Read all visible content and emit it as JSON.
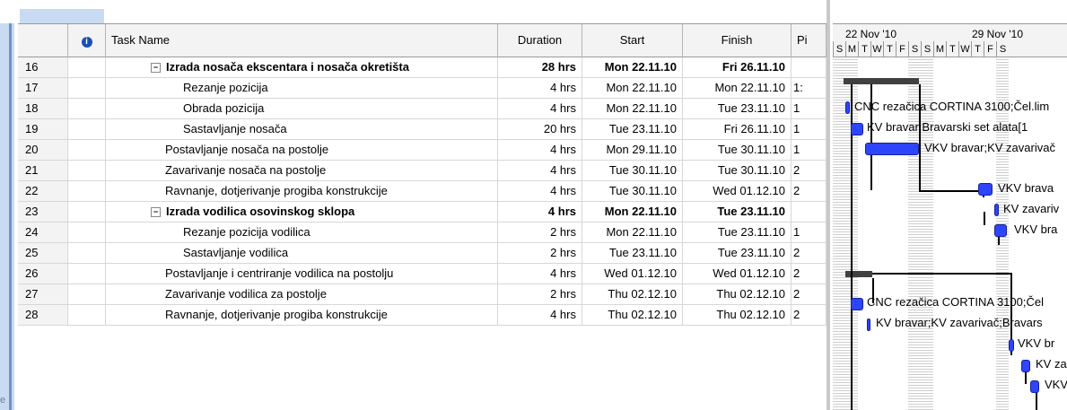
{
  "columns": {
    "info_icon": "i",
    "task_name": "Task Name",
    "duration": "Duration",
    "start": "Start",
    "finish": "Finish",
    "predecessors": "Pi"
  },
  "rows": [
    {
      "id": "16",
      "name": "Izrada nosača ekscentara i nosača okretišta",
      "duration": "28 hrs",
      "start": "Mon 22.11.10",
      "finish": "Fri 26.11.10",
      "pred": "",
      "level": 1,
      "summary": true
    },
    {
      "id": "17",
      "name": "Rezanje pozicija",
      "duration": "4 hrs",
      "start": "Mon 22.11.10",
      "finish": "Mon 22.11.10",
      "pred": "1:",
      "level": 2,
      "summary": false
    },
    {
      "id": "18",
      "name": "Obrada pozicija",
      "duration": "4 hrs",
      "start": "Mon 22.11.10",
      "finish": "Tue 23.11.10",
      "pred": "1",
      "level": 2,
      "summary": false
    },
    {
      "id": "19",
      "name": "Sastavljanje nosača",
      "duration": "20 hrs",
      "start": "Tue 23.11.10",
      "finish": "Fri 26.11.10",
      "pred": "1",
      "level": 2,
      "summary": false
    },
    {
      "id": "20",
      "name": "Postavljanje nosača na postolje",
      "duration": "4 hrs",
      "start": "Mon 29.11.10",
      "finish": "Tue 30.11.10",
      "pred": "1",
      "level": 0,
      "summary": false
    },
    {
      "id": "21",
      "name": "Zavarivanje nosača na postolje",
      "duration": "4 hrs",
      "start": "Tue 30.11.10",
      "finish": "Tue 30.11.10",
      "pred": "2",
      "level": 0,
      "summary": false
    },
    {
      "id": "22",
      "name": "Ravnanje, dotjerivanje progiba konstrukcije",
      "duration": "4 hrs",
      "start": "Tue 30.11.10",
      "finish": "Wed 01.12.10",
      "pred": "2",
      "level": 0,
      "summary": false
    },
    {
      "id": "23",
      "name": "Izrada vodilica osovinskog sklopa",
      "duration": "4 hrs",
      "start": "Mon 22.11.10",
      "finish": "Tue 23.11.10",
      "pred": "",
      "level": 1,
      "summary": true
    },
    {
      "id": "24",
      "name": "Rezanje pozicija vodilica",
      "duration": "2 hrs",
      "start": "Mon 22.11.10",
      "finish": "Tue 23.11.10",
      "pred": "1",
      "level": 2,
      "summary": false
    },
    {
      "id": "25",
      "name": "Sastavljanje vodilica",
      "duration": "2 hrs",
      "start": "Tue 23.11.10",
      "finish": "Tue 23.11.10",
      "pred": "2",
      "level": 2,
      "summary": false
    },
    {
      "id": "26",
      "name": "Postavljanje i centriranje vodilica na postolju",
      "duration": "4 hrs",
      "start": "Wed 01.12.10",
      "finish": "Wed 01.12.10",
      "pred": "2",
      "level": 0,
      "summary": false
    },
    {
      "id": "27",
      "name": "Zavarivanje vodilica za postolje",
      "duration": "2 hrs",
      "start": "Thu 02.12.10",
      "finish": "Thu 02.12.10",
      "pred": "2",
      "level": 0,
      "summary": false
    },
    {
      "id": "28",
      "name": "Ravnanje, dotjerivanje progiba konstrukcije",
      "duration": "4 hrs",
      "start": "Thu 02.12.10",
      "finish": "Thu 02.12.10",
      "pred": "2",
      "level": 0,
      "summary": false
    }
  ],
  "gantt": {
    "weeks": [
      "22 Nov '10",
      "29 Nov '10"
    ],
    "days": [
      "S",
      "M",
      "T",
      "W",
      "T",
      "F",
      "S",
      "S",
      "M",
      "T",
      "W",
      "T",
      "F",
      "S"
    ],
    "labels": {
      "r17": "CNC rezačica CORTINA 3100;Čel.lim",
      "r18": "KV bravar;Bravarski set alata[1",
      "r19": "VKV bravar;KV zavarivač",
      "r20": "VKV brava",
      "r21": "KV zavariv",
      "r22": "VKV bra",
      "r24": "CNC rezačica CORTINA 3100;Čel",
      "r25": "KV bravar;KV zavarivač;Bravars",
      "r26": "VKV br",
      "r27": "KV za",
      "r28": "VKV"
    }
  },
  "bottom_text": "e",
  "colors": {
    "task_bar": "#2e45ff",
    "summary_bar": "#404040",
    "header_bg": "#f3f3f3"
  }
}
